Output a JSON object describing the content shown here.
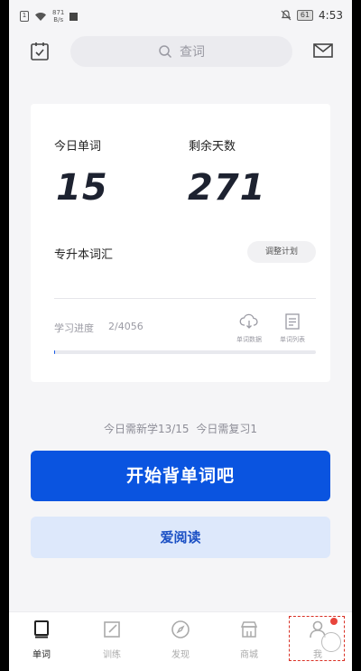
{
  "status_bar": {
    "network_speed": "871\nB/s",
    "battery": "61",
    "time": "4:53"
  },
  "search": {
    "placeholder": "查词",
    "icon": "search-icon"
  },
  "card": {
    "today_words_label": "今日单词",
    "today_words_value": "15",
    "days_left_label": "剩余天数",
    "days_left_value": "271",
    "vocab_name": "专升本词汇",
    "adjust_plan_label": "调整计划",
    "progress_label": "学习进度",
    "progress_value": "2/4056",
    "progress_fraction": 0.0005,
    "tools": [
      {
        "label": "单词数据",
        "icon": "cloud-download-icon"
      },
      {
        "label": "单词列表",
        "icon": "list-icon"
      }
    ]
  },
  "summary": {
    "new_words": "今日需新学13/15",
    "review_words": "今日需复习1"
  },
  "buttons": {
    "start": "开始背单词吧",
    "reading": "爱阅读"
  },
  "bottom_nav": [
    {
      "label": "单词",
      "icon": "book-icon",
      "active": true
    },
    {
      "label": "训练",
      "icon": "edit-icon",
      "active": false
    },
    {
      "label": "发现",
      "icon": "compass-icon",
      "active": false
    },
    {
      "label": "商城",
      "icon": "store-icon",
      "active": false
    },
    {
      "label": "我",
      "icon": "user-icon",
      "active": false
    }
  ],
  "colors": {
    "primary": "#0a54e0",
    "secondary_bg": "#dde8fb",
    "highlight": "#d93025"
  }
}
